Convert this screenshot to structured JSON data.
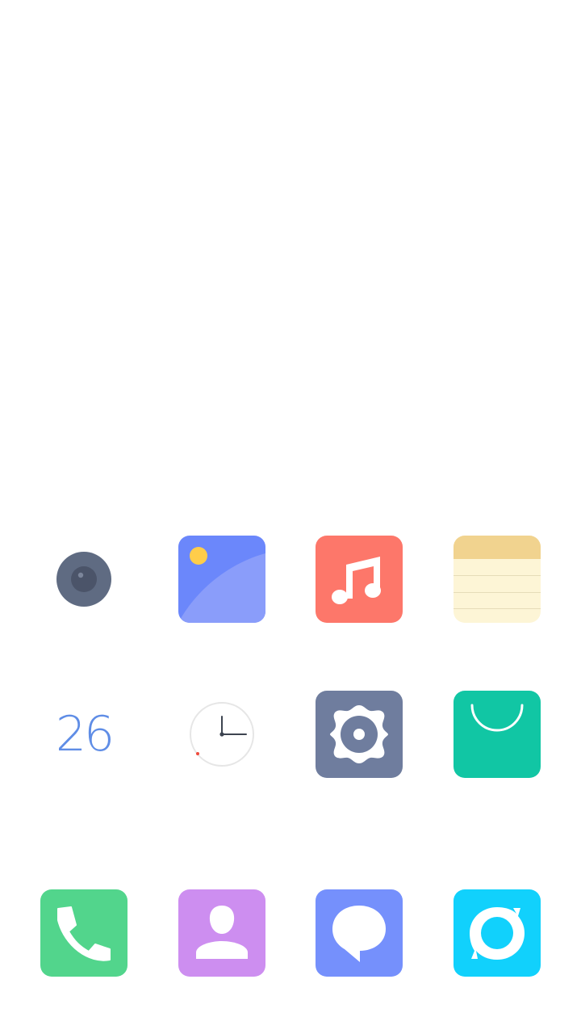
{
  "home_screen": {
    "apps": [
      {
        "id": "camera",
        "icon": "camera-icon",
        "color": "#5f6b82"
      },
      {
        "id": "gallery",
        "icon": "gallery-icon",
        "color": "#6b87fb"
      },
      {
        "id": "music",
        "icon": "music-note-icon",
        "color": "#fd776a"
      },
      {
        "id": "notes",
        "icon": "notepad-icon",
        "color": "#fdf5d6"
      },
      {
        "id": "calendar",
        "icon": "calendar-icon",
        "day": "26",
        "color": "#5f8de6"
      },
      {
        "id": "clock",
        "icon": "clock-icon",
        "color": "#f2f2f2"
      },
      {
        "id": "settings",
        "icon": "gear-icon",
        "color": "#6f7d9e"
      },
      {
        "id": "app-store",
        "icon": "shopping-bag-icon",
        "color": "#11c6a4"
      }
    ],
    "dock": [
      {
        "id": "phone",
        "icon": "phone-icon",
        "color": "#52d58c"
      },
      {
        "id": "contacts",
        "icon": "contact-person-icon",
        "color": "#cd8ef0"
      },
      {
        "id": "messages",
        "icon": "message-bubble-icon",
        "color": "#7590fc"
      },
      {
        "id": "browser",
        "icon": "browser-icon",
        "color": "#11d1fc"
      }
    ]
  }
}
